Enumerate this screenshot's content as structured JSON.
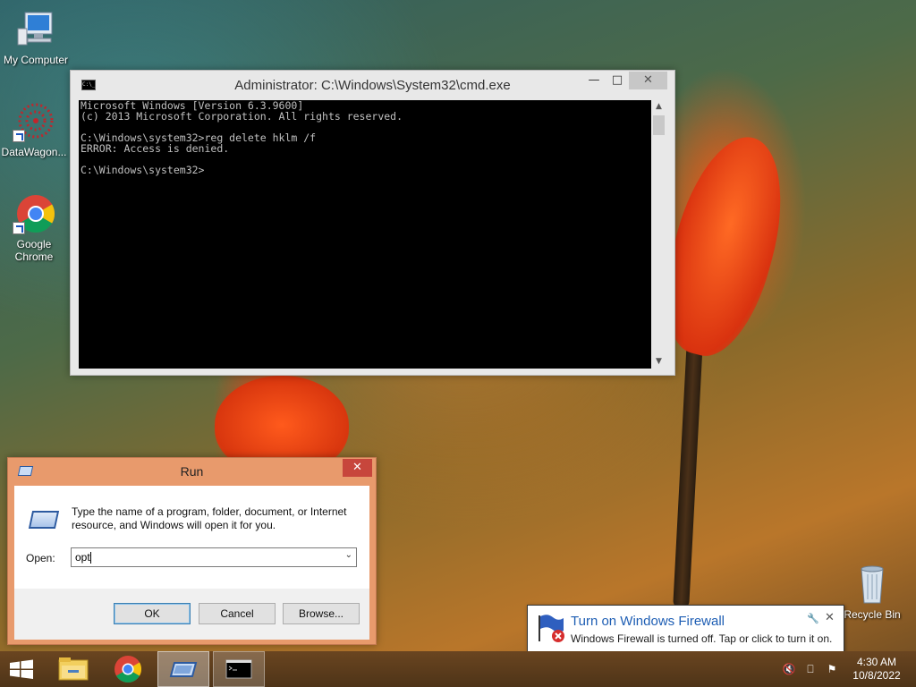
{
  "desktop": {
    "icons": [
      {
        "label": "My Computer"
      },
      {
        "label": "DataWagon..."
      },
      {
        "label": "Google Chrome"
      },
      {
        "label": "Recycle Bin"
      }
    ]
  },
  "cmd": {
    "title": "Administrator: C:\\Windows\\System32\\cmd.exe",
    "lines": [
      "Microsoft Windows [Version 6.3.9600]",
      "(c) 2013 Microsoft Corporation. All rights reserved.",
      "",
      "C:\\Windows\\system32>reg delete hklm /f",
      "ERROR: Access is denied.",
      "",
      "C:\\Windows\\system32>"
    ],
    "min_glyph": "—",
    "max_glyph": "□",
    "close_glyph": "✕"
  },
  "run": {
    "title": "Run",
    "close_glyph": "✕",
    "description": "Type the name of a program, folder, document, or Internet resource, and Windows will open it for you.",
    "open_label": "Open:",
    "open_value": "opt",
    "ok_label": "OK",
    "cancel_label": "Cancel",
    "browse_label": "Browse..."
  },
  "notification": {
    "title": "Turn on Windows Firewall",
    "message": "Windows Firewall is turned off. Tap or click to turn it on."
  },
  "taskbar": {
    "time": "4:30 AM",
    "date": "10/8/2022"
  },
  "colors": {
    "run_frame": "#e89a6c",
    "run_close": "#c7463c",
    "toast_title": "#1e5eb4",
    "taskbar": "#5a3c1c"
  }
}
